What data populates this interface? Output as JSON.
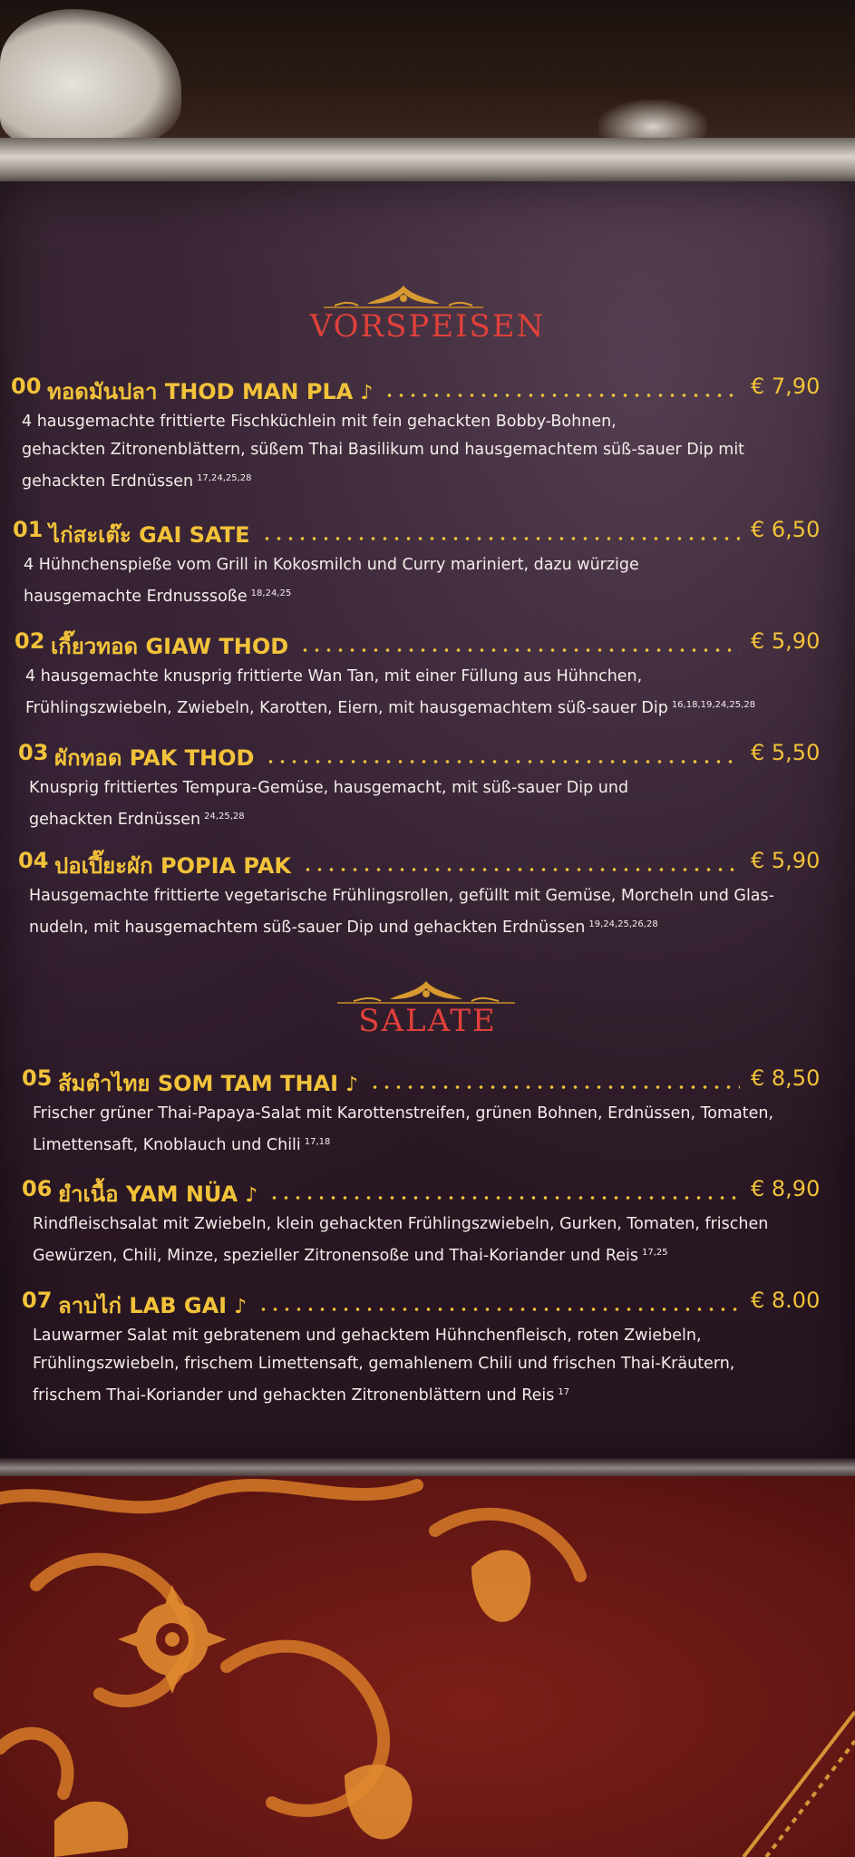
{
  "sections": [
    {
      "title": "VORSPEISEN"
    },
    {
      "title": "SALATE"
    }
  ],
  "items": [
    {
      "num": "00",
      "name": "ทอดมันปลา THOD MAN PLA",
      "spicy": "🌶",
      "price": "€ 7,90",
      "desc": "4 hausgemachte frittierte Fischküchlein mit fein gehackten Bobby-Bohnen,\ngehackten Zitronenblättern, süßem Thai Basilikum und hausgemachtem süß-sauer Dip mit\ngehackten Erdnüssen",
      "allergens": "17,24,25,28"
    },
    {
      "num": "01",
      "name": "ไก่สะเต๊ะ GAI SATE",
      "spicy": "",
      "price": "€ 6,50",
      "desc": "4 Hühnchenspieße vom Grill in Kokosmilch und Curry mariniert, dazu würzige\nhausgemachte Erdnusssoße",
      "allergens": "18,24,25"
    },
    {
      "num": "02",
      "name": "เกี๊ยวทอด GIAW THOD",
      "spicy": "",
      "price": "€ 5,90",
      "desc": "4 hausgemachte knusprig frittierte Wan Tan, mit einer Füllung aus Hühnchen,\nFrühlingszwiebeln, Zwiebeln, Karotten, Eiern, mit hausgemachtem süß-sauer Dip",
      "allergens": "16,18,19,24,25,28"
    },
    {
      "num": "03",
      "name": "ผักทอด PAK THOD",
      "spicy": "",
      "price": "€ 5,50",
      "desc": "Knusprig frittiertes Tempura-Gemüse, hausgemacht, mit süß-sauer Dip und\ngehackten Erdnüssen",
      "allergens": "24,25,28"
    },
    {
      "num": "04",
      "name": "ปอเปี๊ยะผัก POPIA PAK",
      "spicy": "",
      "price": "€ 5,90",
      "desc": "Hausgemachte frittierte vegetarische Frühlingsrollen, gefüllt mit Gemüse, Morcheln und Glas-\nnudeln, mit hausgemachtem süß-sauer Dip und gehackten Erdnüssen",
      "allergens": "19,24,25,26,28"
    },
    {
      "num": "05",
      "name": "ส้มตำไทย SOM TAM THAI",
      "spicy": "🌶",
      "price": "€ 8,50",
      "desc": "Frischer grüner Thai-Papaya-Salat mit Karottenstreifen, grünen Bohnen, Erdnüssen, Tomaten,\nLimettensaft, Knoblauch und Chili",
      "allergens": "17,18"
    },
    {
      "num": "06",
      "name": "ยำเนื้อ YAM NÜA",
      "spicy": "🌶",
      "price": "€ 8,90",
      "desc": "Rindfleischsalat mit Zwiebeln, klein gehackten Frühlingszwiebeln, Gurken, Tomaten, frischen\nGewürzen, Chili, Minze, spezieller Zitronensoße und Thai-Koriander und Reis",
      "allergens": "17,25"
    },
    {
      "num": "07",
      "name": "ลาบไก่ LAB GAI",
      "spicy": "🌶",
      "price": "€ 8.00",
      "desc": "Lauwarmer Salat mit gebratenem und gehacktem Hühnchenfleisch, roten Zwiebeln,\nFrühlingszwiebeln, frischem Limettensaft, gemahlenem Chili und frischen Thai-Kräutern,\nfrischem Thai-Koriander und gehackten Zitronenblättern und Reis",
      "allergens": "17"
    }
  ]
}
